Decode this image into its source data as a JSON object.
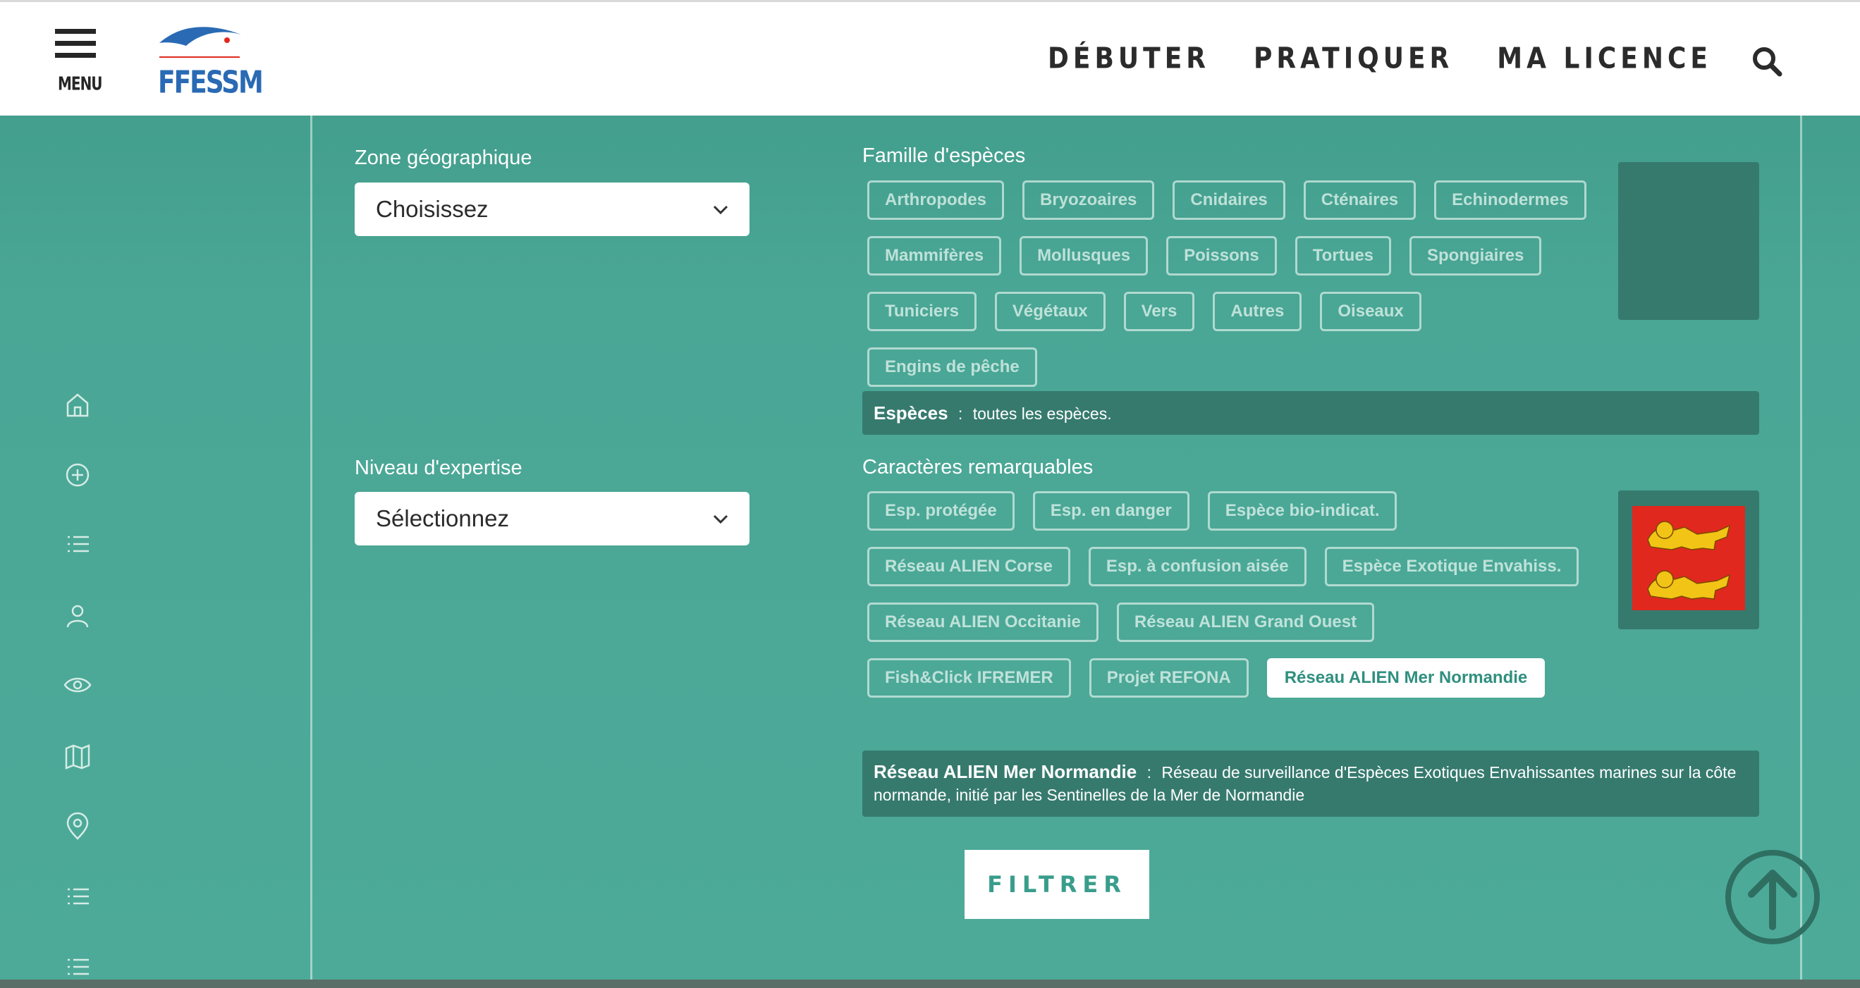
{
  "header": {
    "menu_label": "MENU",
    "logo_text": "FFESSM",
    "nav": [
      "DÉBUTER",
      "PRATIQUER",
      "MA LICENCE"
    ]
  },
  "filters": {
    "zone_label": "Zone géographique",
    "zone_value": "Choisissez",
    "level_label": "Niveau d'expertise",
    "level_value": "Sélectionnez",
    "family_label": "Famille d'espèces",
    "families": [
      "Arthropodes",
      "Bryozoaires",
      "Cnidaires",
      "Cténaires",
      "Echinodermes",
      "Mammifères",
      "Mollusques",
      "Poissons",
      "Tortues",
      "Spongiaires",
      "Tuniciers",
      "Végétaux",
      "Vers",
      "Autres",
      "Oiseaux",
      "Engins de pêche"
    ],
    "species_title": "Espèces",
    "species_sep": ":",
    "species_desc": "toutes les espèces.",
    "traits_label": "Caractères remarquables",
    "traits": [
      "Esp. protégée",
      "Esp. en danger",
      "Espèce bio-indicat.",
      "Réseau ALIEN Corse",
      "Esp. à confusion aisée",
      "Espèce Exotique Envahiss.",
      "Réseau ALIEN Occitanie",
      "Réseau ALIEN Grand Ouest",
      "Fish&Click IFREMER",
      "Projet REFONA",
      "Réseau ALIEN Mer Normandie"
    ],
    "active_trait_index": 10,
    "trait_title": "Réseau ALIEN Mer Normandie",
    "trait_sep": ":",
    "trait_desc": "Réseau de surveillance d'Espèces Exotiques Envahissantes marines sur la côte normande, initié par les Sentinelles de la Mer de Normandie",
    "filter_button": "FILTRER"
  },
  "icons": [
    "home-icon",
    "add-circle-icon",
    "list-icon",
    "user-icon",
    "eye-icon",
    "map-icon",
    "location-pin-icon",
    "list-icon",
    "list-icon",
    "search-icon",
    "chevron-down-icon",
    "arrow-up-circle-icon",
    "normandy-flag-icon"
  ],
  "colors": {
    "teal_bg": "#4aa695",
    "info_bg": "#367a6e",
    "logo_blue": "#2a6ab4",
    "flag_red": "#e0281e",
    "flag_gold": "#f2c416"
  }
}
